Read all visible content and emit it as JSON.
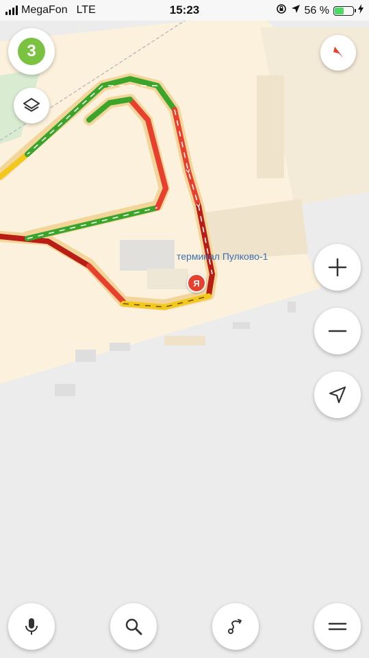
{
  "status_bar": {
    "carrier": "MegaFon",
    "network": "LTE",
    "time": "15:23",
    "battery_percent": "56 %",
    "battery_level": 0.56
  },
  "map": {
    "place_label": "терминал Пулково-1",
    "user_marker_label": "Я",
    "route_colors": {
      "free": "#3aa52a",
      "moderate": "#f2c81a",
      "heavy": "#e8402f",
      "jam": "#b81e16"
    }
  },
  "traffic": {
    "level": "3"
  },
  "controls": {
    "layers": "layers-icon",
    "compass": "compass-icon",
    "zoom_in": "plus-icon",
    "zoom_out": "minus-icon",
    "locate": "location-arrow-icon"
  },
  "bottom_bar": {
    "voice": "microphone-icon",
    "search": "search-icon",
    "routes": "route-icon",
    "menu": "menu-icon"
  }
}
